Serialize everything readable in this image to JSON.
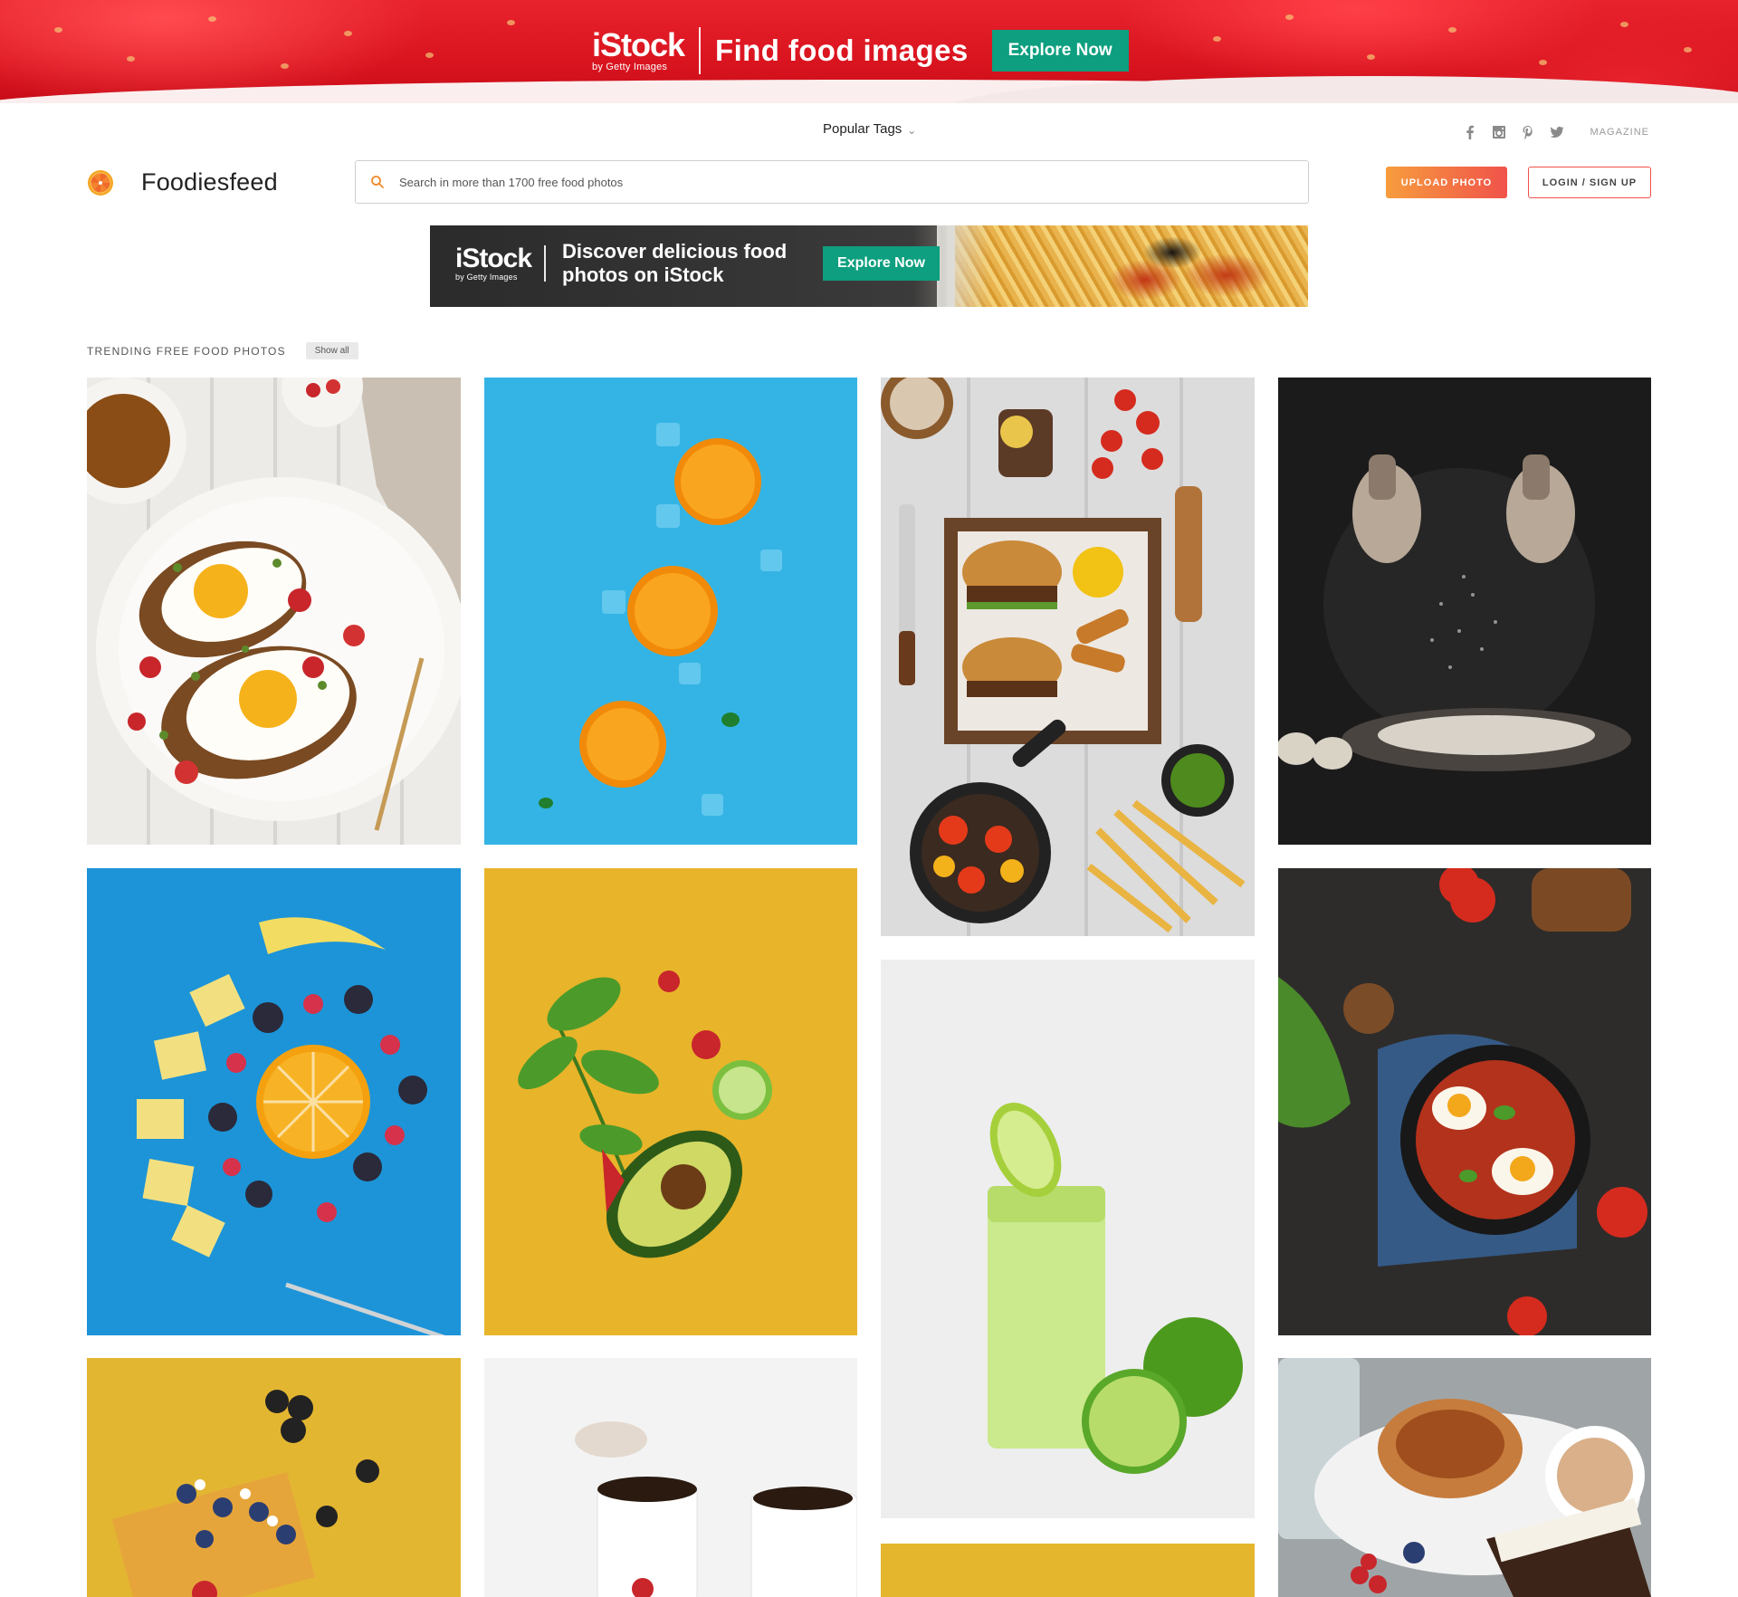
{
  "top_ad": {
    "brand": "iStock",
    "brand_sub": "by Getty Images",
    "headline": "Find food images",
    "cta": "Explore Now"
  },
  "header": {
    "popular_tags": "Popular Tags",
    "social_icons": [
      "facebook-icon",
      "instagram-icon",
      "pinterest-icon",
      "twitter-icon"
    ],
    "magazine": "MAGAZINE",
    "logo_text": "Foodiesfeed",
    "search_placeholder": "Search in more than 1700 free food photos",
    "upload_label": "UPLOAD PHOTO",
    "login_label": "LOGIN / SIGN UP"
  },
  "secondary_ad": {
    "brand": "iStock",
    "brand_sub": "by Getty Images",
    "headline": "Discover delicious food photos on iStock",
    "cta": "Explore Now"
  },
  "trending": {
    "title": "TRENDING FREE FOOD PHOTOS",
    "show_all": "Show all"
  },
  "colors": {
    "accent_green": "#0d9f7f",
    "upload_gradient_start": "#f79d3e",
    "upload_gradient_end": "#f0524a",
    "banner_red": "#d9141f"
  }
}
